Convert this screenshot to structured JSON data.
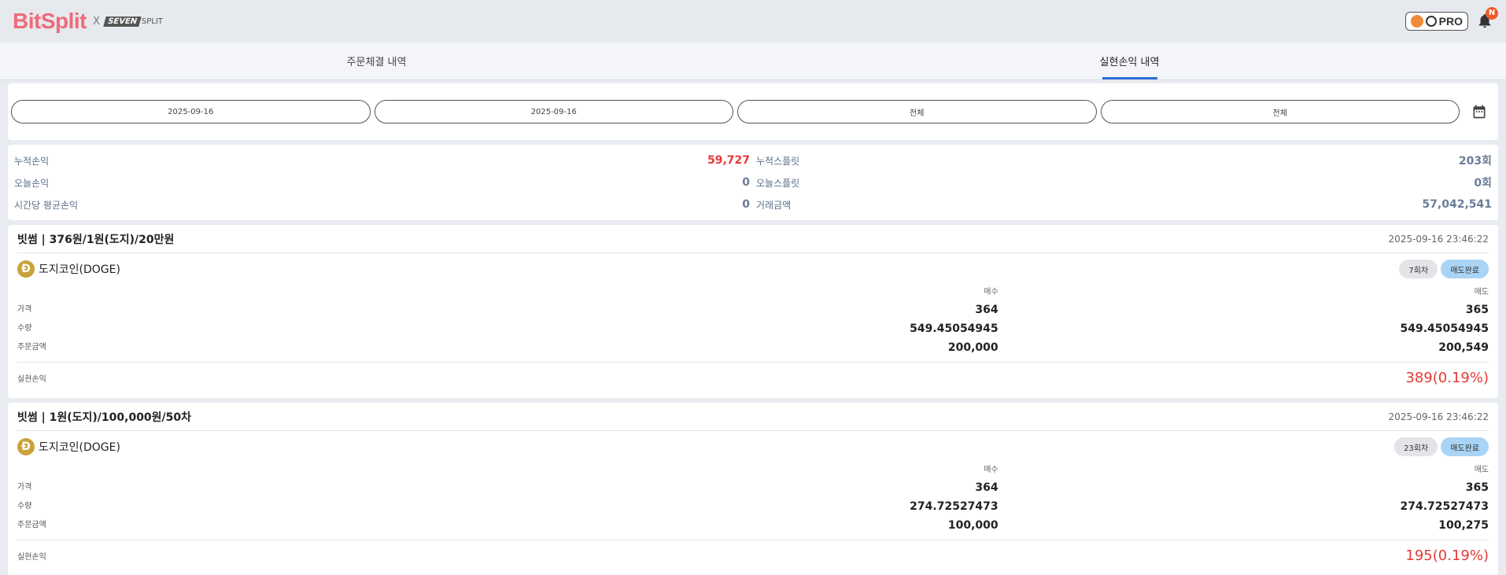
{
  "header": {
    "brand": "BitSplit",
    "x": "X",
    "partner_seven": "SEVEN",
    "partner_split": "SPLIT",
    "pro_label": "PRO",
    "notification_badge": "N"
  },
  "tabs": [
    {
      "label": "주문체결 내역",
      "active": false
    },
    {
      "label": "실현손익 내역",
      "active": true
    }
  ],
  "filters": {
    "start_date": "2025-09-16",
    "end_date": "2025-09-16",
    "filter_1": "전체",
    "filter_2": "전체"
  },
  "summary": {
    "left": [
      {
        "label": "누적손익",
        "value": "59,727"
      },
      {
        "label": "오늘손익",
        "value": "0"
      },
      {
        "label": "시간당 평균손익",
        "value": "0"
      }
    ],
    "right": [
      {
        "label": "누적스플릿",
        "value": "203회"
      },
      {
        "label": "오늘스플릿",
        "value": "0회"
      },
      {
        "label": "거래금액",
        "value": "57,042,541"
      }
    ]
  },
  "trades": [
    {
      "title": "빗썸 | 376원/1원(도지)/20만원",
      "time": "2025-09-16 23:46:22",
      "coin": "도지코인(DOGE)",
      "round": "7회차",
      "status": "매도완료",
      "col_buy": "매수",
      "col_sell": "매도",
      "rows": [
        {
          "label": "가격",
          "buy": "364",
          "sell": "365"
        },
        {
          "label": "수량",
          "buy": "549.45054945",
          "sell": "549.45054945"
        },
        {
          "label": "주문금액",
          "buy": "200,000",
          "sell": "200,549"
        }
      ],
      "pnl_label": "실현손익",
      "pnl_value": "389(0.19%)"
    },
    {
      "title": "빗썸 | 1원(도지)/100,000원/50차",
      "time": "2025-09-16 23:46:22",
      "coin": "도지코인(DOGE)",
      "round": "23회차",
      "status": "매도완료",
      "col_buy": "매수",
      "col_sell": "매도",
      "rows": [
        {
          "label": "가격",
          "buy": "364",
          "sell": "365"
        },
        {
          "label": "수량",
          "buy": "274.72527473",
          "sell": "274.72527473"
        },
        {
          "label": "주문금액",
          "buy": "100,000",
          "sell": "100,275"
        }
      ],
      "pnl_label": "실현손익",
      "pnl_value": "195(0.19%)"
    }
  ],
  "colors": {
    "brand": "#f06a78",
    "accent": "#2a6fd6",
    "profit": "#e53935",
    "status_done": "#a9d4f5"
  }
}
